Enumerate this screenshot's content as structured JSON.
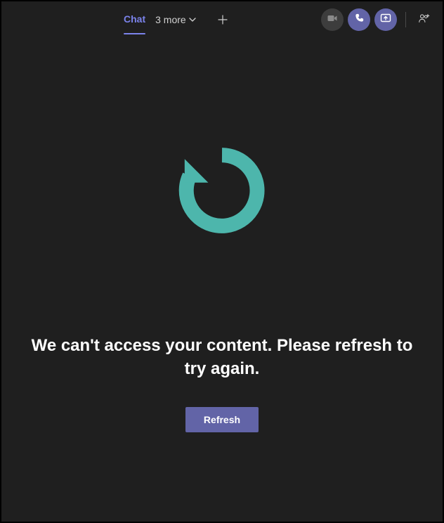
{
  "header": {
    "active_tab": "Chat",
    "more_tabs_label": "3 more",
    "add_tab_symbol": "+"
  },
  "icons": {
    "video": "video-icon",
    "phone": "phone-icon",
    "share": "share-screen-icon",
    "add_people": "add-people-icon",
    "chevron_down": "chevron-down-icon",
    "refresh_large": "refresh-icon"
  },
  "main": {
    "error_message": "We can't access your content. Please refresh to try again.",
    "refresh_button_label": "Refresh"
  },
  "colors": {
    "accent": "#6264a7",
    "tab_active": "#7b83eb",
    "refresh_icon": "#4db6ac"
  }
}
